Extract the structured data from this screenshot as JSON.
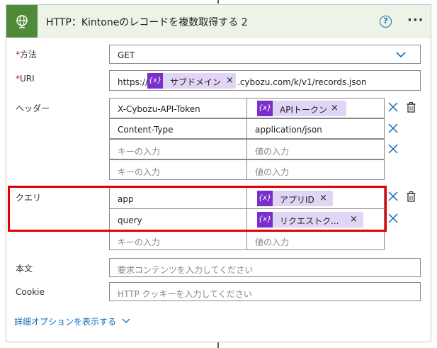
{
  "header": {
    "title": "HTTP：Kintoneのレコードを複数取得する 2",
    "help_icon": "question-circle-icon",
    "more_icon": "ellipsis-icon",
    "more_label": "···",
    "help_label": "?",
    "action_icon": "globe-icon"
  },
  "method": {
    "required_mark": "*",
    "label": "方法",
    "value": "GET"
  },
  "uri": {
    "required_mark": "*",
    "label": "URI",
    "prefix": "https://",
    "token": "サブドメイン",
    "suffix": ".cybozu.com/k/v1/records.json"
  },
  "token_icon_label": "{x}",
  "remove_label": "×",
  "headers": {
    "label": "ヘッダー",
    "rows": [
      {
        "key": "X-Cybozu-API-Token",
        "value_token": "APIトークン"
      },
      {
        "key": "Content-Type",
        "value": "application/json"
      }
    ],
    "key_placeholder": "キーの入力",
    "value_placeholder": "値の入力"
  },
  "query": {
    "label": "クエリ",
    "rows": [
      {
        "key": "app",
        "value_token": "アプリID"
      },
      {
        "key": "query",
        "value_token": "リクエストク..."
      }
    ],
    "key_placeholder": "キーの入力",
    "value_placeholder": "値の入力"
  },
  "body": {
    "label": "本文",
    "placeholder": "要求コンテンツを入力してください"
  },
  "cookie": {
    "label": "Cookie",
    "placeholder": "HTTP クッキーを入力してください"
  },
  "advanced": {
    "label": "詳細オプションを表示する"
  },
  "colors": {
    "accent": "#0f6cbd",
    "header_bg": "#eef3e8",
    "icon_bg": "#4e8a38",
    "token_bg": "#e1d5f5",
    "token_icon": "#7a2fcc",
    "highlight": "#e00000"
  }
}
